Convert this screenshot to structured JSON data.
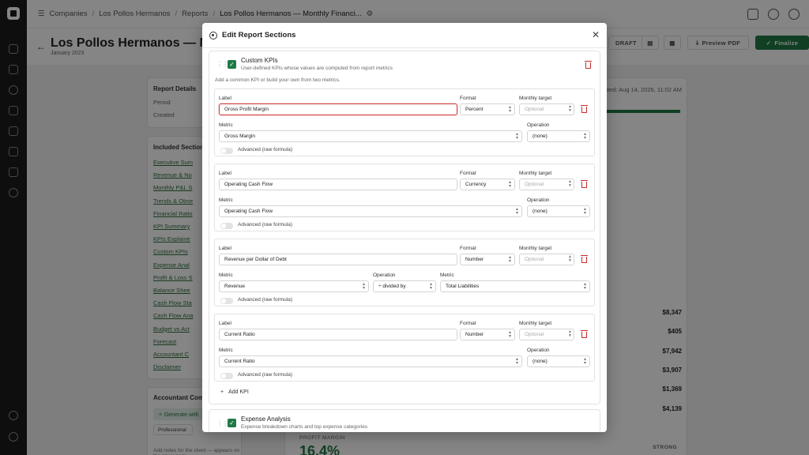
{
  "colors": {
    "accent": "#1f7a45",
    "danger": "#c62828",
    "link": "#2f6f3a"
  },
  "breadcrumbs": [
    "Companies",
    "Los Pollos Hermanos",
    "Reports",
    "Los Pollos Hermanos — Monthly Financi..."
  ],
  "page": {
    "title": "Los Pollos Hermanos — Month",
    "subtitle": "January 2023",
    "draft_label": "DRAFT",
    "preview_label": "Preview PDF",
    "finalize_label": "Finalize",
    "generated_text": "erated: Aug 14, 2026, 11:02 AM"
  },
  "report_details": {
    "heading": "Report Details",
    "period_label": "Period",
    "created_label": "Created"
  },
  "included_sections": {
    "heading": "Included Section",
    "items": [
      "Executive Sum",
      "Revenue & No",
      "Monthly P&L S",
      "Trends & Obse",
      "Financial Ratio",
      "KPI Summary",
      "KPIs Explaine",
      "Custom KPIs",
      "Expense Anal",
      "Profit & Loss S",
      "Balance Shee",
      "Cash Flow Sta",
      "Cash Flow Ana",
      "Budget vs Act",
      "Forecast",
      "Accountant C",
      "Disclaimer"
    ]
  },
  "accountant": {
    "heading": "Accountant Com",
    "generate_label": "Generate with",
    "tone_label": "Professional",
    "notes_hint": "Add notes for the client — appears on the cover page"
  },
  "bg_values": [
    "$8,347",
    "$405",
    "$7,942",
    "$3,907",
    "$1,369",
    "$4,139"
  ],
  "bg_profit": {
    "label": "PROFIT MARGIN",
    "value": "16.4%",
    "badge": "STRONG"
  },
  "modal": {
    "title": "Edit Report Sections",
    "custom_kpis": {
      "title": "Custom KPIs",
      "description": "User-defined KPIs whose values are computed from report metrics",
      "hint": "Add a common KPI or build your own from two metrics."
    },
    "field_labels": {
      "label": "Label",
      "format": "Format",
      "monthly_target": "Monthly target",
      "metric": "Metric",
      "operation": "Operation",
      "advanced": "Advanced (raw formula)",
      "target_placeholder": "Optional"
    },
    "kpis": [
      {
        "label": "Gross Profit Margin",
        "format": "Percent",
        "metric": "Gross Margin",
        "operation": "(none)"
      },
      {
        "label": "Operating Cash Flow",
        "format": "Currency",
        "metric": "Operating Cash Flow",
        "operation": "(none)"
      },
      {
        "label": "Revenue per Dollar of Debt",
        "format": "Number",
        "metric": "Revenue",
        "operation": "÷ divided by",
        "metric2": "Total Liabilities"
      },
      {
        "label": "Current Ratio",
        "format": "Number",
        "metric": "Current Ratio",
        "operation": "(none)"
      }
    ],
    "add_kpi_label": "Add KPI",
    "expense_analysis": {
      "title": "Expense Analysis",
      "description": "Expense breakdown charts and top expense categories"
    }
  }
}
